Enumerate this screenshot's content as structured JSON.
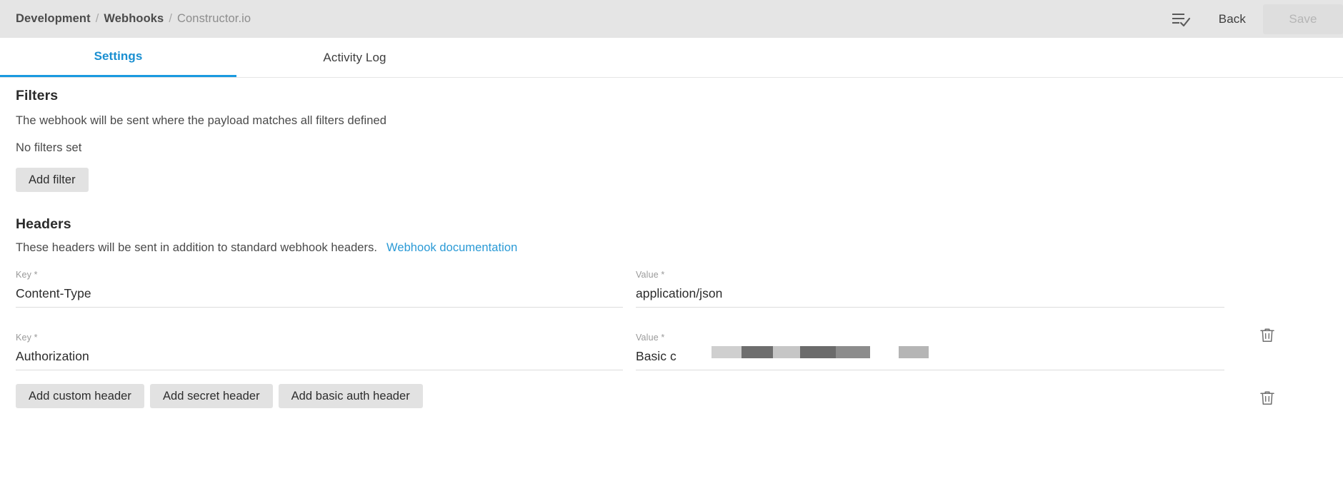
{
  "topbar": {
    "breadcrumb": {
      "items": [
        "Development",
        "Webhooks",
        "Constructor.io"
      ],
      "separator": "/"
    },
    "list_check_icon": "list-check-icon",
    "back_label": "Back",
    "save_label": "Save",
    "save_disabled": true,
    "background": "#e5e5e5"
  },
  "tabs": [
    {
      "label": "Settings",
      "active": true
    },
    {
      "label": "Activity Log",
      "active": false
    }
  ],
  "accent_color": "#1a9ae0",
  "link_color": "#2a9ad6",
  "filters": {
    "title": "Filters",
    "description": "The webhook will be sent where the payload matches all filters defined",
    "empty_state": "No filters set",
    "add_button": "Add filter"
  },
  "headers": {
    "title": "Headers",
    "description": "These headers will be sent in addition to standard webhook headers.",
    "doc_link": "Webhook documentation",
    "key_label": "Key *",
    "value_label": "Value *",
    "rows": [
      {
        "key": "Content-Type",
        "value": "application/json",
        "redacted": false,
        "delete_icon": "trash-icon"
      },
      {
        "key": "Authorization",
        "value": "Basic c",
        "redacted": true,
        "delete_icon": "trash-icon"
      }
    ],
    "buttons": [
      "Add custom header",
      "Add secret header",
      "Add basic auth header"
    ]
  }
}
